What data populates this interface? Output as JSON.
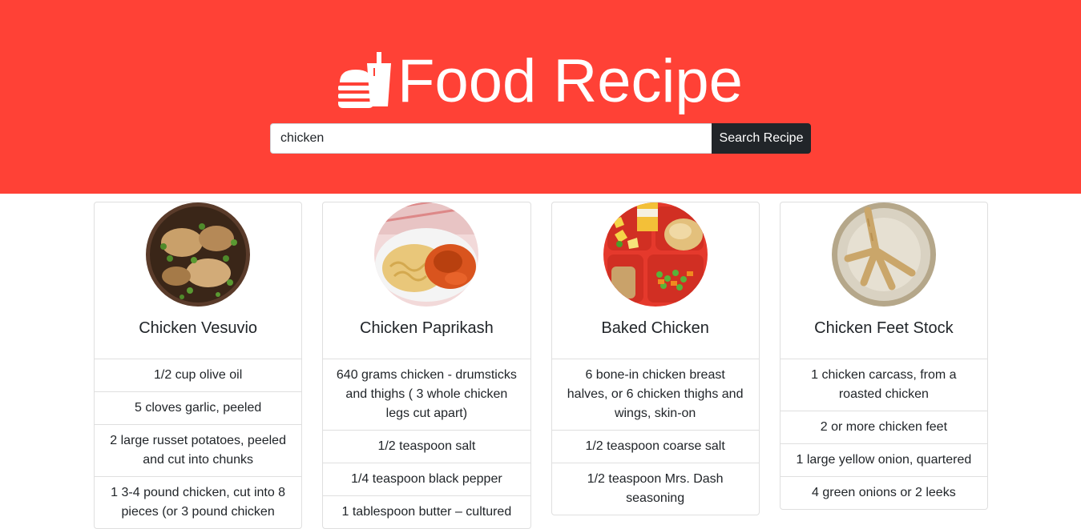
{
  "header": {
    "brand": "Food Recipe",
    "logo_icon": "burger-and-drink-icon",
    "background_color": "#ff4136"
  },
  "search": {
    "value": "chicken",
    "button_label": "Search Recipe"
  },
  "recipes": [
    {
      "title": "Chicken Vesuvio",
      "image": "chicken-vesuvio-photo",
      "ingredients": [
        "1/2 cup olive oil",
        "5 cloves garlic, peeled",
        "2 large russet potatoes, peeled and cut into chunks",
        "1 3-4 pound chicken, cut into 8 pieces (or 3 pound chicken"
      ]
    },
    {
      "title": "Chicken Paprikash",
      "image": "chicken-paprikash-photo",
      "ingredients": [
        "640 grams chicken - drumsticks and thighs ( 3 whole chicken legs cut apart)",
        "1/2 teaspoon salt",
        "1/4 teaspoon black pepper",
        "1 tablespoon butter – cultured"
      ]
    },
    {
      "title": "Baked Chicken",
      "image": "baked-chicken-photo",
      "ingredients": [
        "6 bone-in chicken breast halves, or 6 chicken thighs and wings, skin-on",
        "1/2 teaspoon coarse salt",
        "1/2 teaspoon Mrs. Dash seasoning"
      ]
    },
    {
      "title": "Chicken Feet Stock",
      "image": "chicken-feet-stock-photo",
      "ingredients": [
        "1 chicken carcass, from a roasted chicken",
        "2 or more chicken feet",
        "1 large yellow onion, quartered",
        "4 green onions or 2 leeks"
      ]
    }
  ]
}
